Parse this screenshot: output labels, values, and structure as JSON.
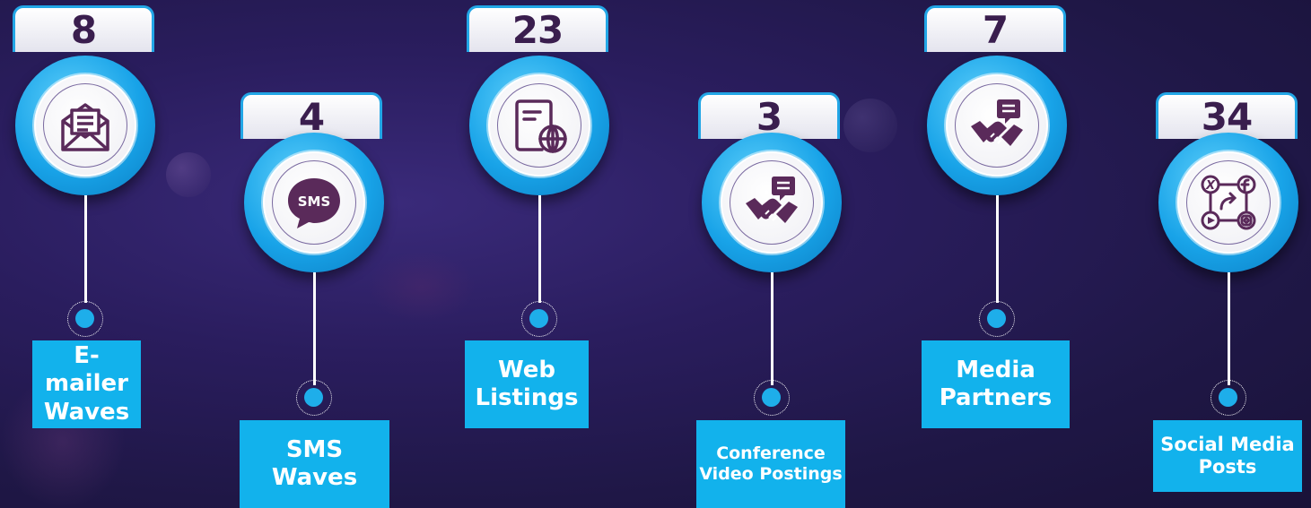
{
  "items": [
    {
      "count": "8",
      "label": "E-mailer\nWaves",
      "icon": "envelope-icon"
    },
    {
      "count": "4",
      "label": "SMS\nWaves",
      "icon": "sms-bubble-icon",
      "icon_text": "SMS"
    },
    {
      "count": "23",
      "label": "Web\nListings",
      "icon": "web-document-icon"
    },
    {
      "count": "3",
      "label": "Conference\nVideo Postings",
      "icon": "handshake-chat-icon"
    },
    {
      "count": "7",
      "label": "Media\nPartners",
      "icon": "handshake-chat-icon"
    },
    {
      "count": "34",
      "label": "Social Media\nPosts",
      "icon": "social-media-icon",
      "icon_text": "X"
    }
  ],
  "colors": {
    "accent": "#12b2ec",
    "number_text": "#3a1e4e",
    "icon": "#5a2a5a",
    "background": "#231a4f"
  }
}
